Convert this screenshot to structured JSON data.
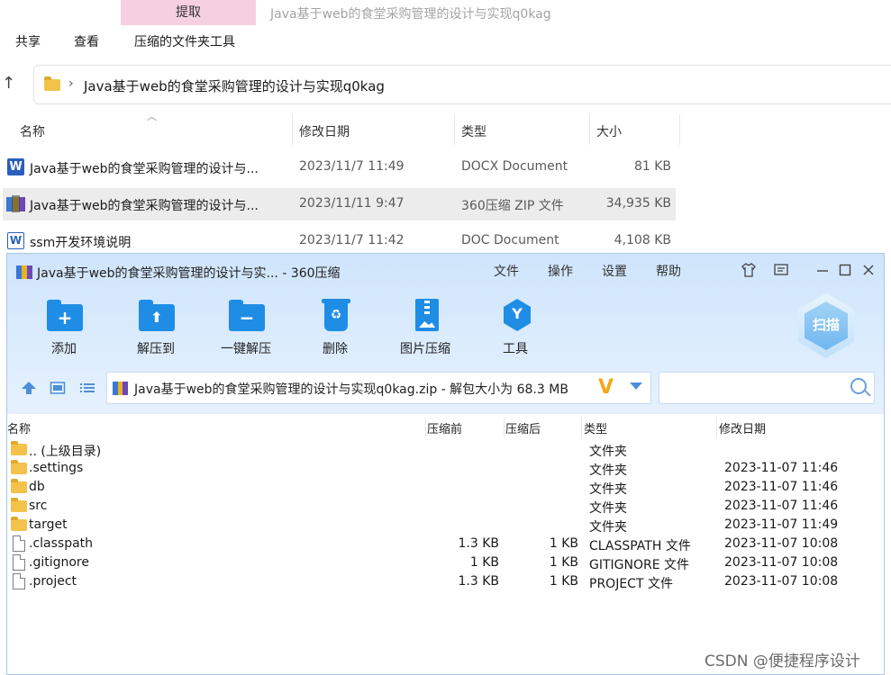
{
  "explorer": {
    "extract_tab": "提取",
    "window_title": "Java基于web的食堂采购管理的设计与实现q0kag",
    "menu": [
      "共享",
      "查看",
      "压缩的文件夹工具"
    ],
    "address": "Java基于web的食堂采购管理的设计与实现q0kag",
    "columns": [
      "名称",
      "修改日期",
      "类型",
      "大小"
    ],
    "files": [
      {
        "name": "Java基于web的食堂采购管理的设计与...",
        "date": "2023/11/7 11:49",
        "type": "DOCX Document",
        "size": "81 KB",
        "icon": "word-docx-icon"
      },
      {
        "name": "Java基于web的食堂采购管理的设计与...",
        "date": "2023/11/11 9:47",
        "type": "360压缩 ZIP 文件",
        "size": "34,935 KB",
        "icon": "zip-archive-icon"
      },
      {
        "name": "ssm开发环境说明",
        "date": "2023/11/7 11:42",
        "type": "DOC Document",
        "size": "4,108 KB",
        "icon": "word-doc-icon"
      }
    ]
  },
  "zip": {
    "title": "Java基于web的食堂采购管理的设计与实... - 360压缩",
    "menu": [
      "文件",
      "操作",
      "设置",
      "帮助"
    ],
    "tools": [
      {
        "label": "添加",
        "icon": "add-folder-icon"
      },
      {
        "label": "解压到",
        "icon": "extract-to-icon"
      },
      {
        "label": "一键解压",
        "icon": "one-click-extract-icon"
      },
      {
        "label": "删除",
        "icon": "delete-bin-icon"
      },
      {
        "label": "图片压缩",
        "icon": "image-compress-icon"
      },
      {
        "label": "工具",
        "icon": "tools-icon"
      }
    ],
    "scan_label": "扫描",
    "path": "Java基于web的食堂采购管理的设计与实现q0kag.zip - 解包大小为 68.3 MB",
    "search_placeholder": "",
    "columns": [
      "名称",
      "压缩前",
      "压缩后",
      "类型",
      "修改日期"
    ],
    "rows": [
      {
        "name": ".. (上级目录)",
        "before": "",
        "after": "",
        "type": "文件夹",
        "date": "",
        "kind": "folder"
      },
      {
        "name": ".settings",
        "before": "",
        "after": "",
        "type": "文件夹",
        "date": "2023-11-07 11:46",
        "kind": "folder"
      },
      {
        "name": "db",
        "before": "",
        "after": "",
        "type": "文件夹",
        "date": "2023-11-07 11:46",
        "kind": "folder"
      },
      {
        "name": "src",
        "before": "",
        "after": "",
        "type": "文件夹",
        "date": "2023-11-07 11:46",
        "kind": "folder"
      },
      {
        "name": "target",
        "before": "",
        "after": "",
        "type": "文件夹",
        "date": "2023-11-07 11:49",
        "kind": "folder"
      },
      {
        "name": ".classpath",
        "before": "1.3 KB",
        "after": "1 KB",
        "type": "CLASSPATH 文件",
        "date": "2023-11-07 10:08",
        "kind": "file"
      },
      {
        "name": ".gitignore",
        "before": "1 KB",
        "after": "1 KB",
        "type": "GITIGNORE 文件",
        "date": "2023-11-07 10:08",
        "kind": "file"
      },
      {
        "name": ".project",
        "before": "1.3 KB",
        "after": "1 KB",
        "type": "PROJECT 文件",
        "date": "2023-11-07 10:08",
        "kind": "file"
      }
    ]
  },
  "watermark": "CSDN @便捷程序设计"
}
